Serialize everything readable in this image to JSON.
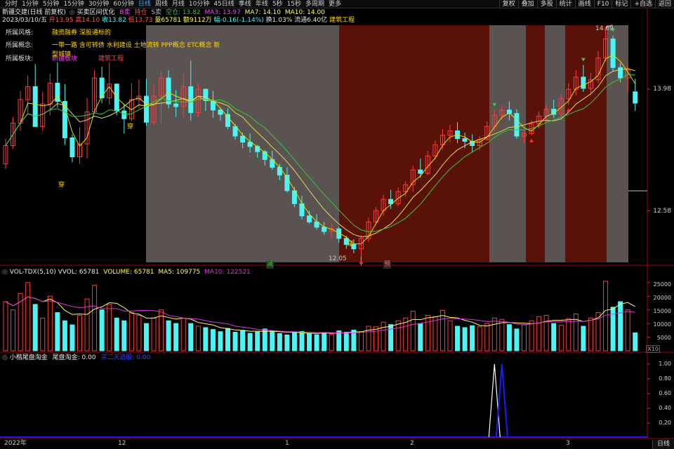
{
  "topbar": {
    "periods": [
      "分时",
      "1分钟",
      "5分钟",
      "15分钟",
      "30分钟",
      "60分钟",
      "日线",
      "周线",
      "月线",
      "10分钟",
      "45日线",
      "季线",
      "年线",
      "5秒",
      "15秒",
      "多周期",
      "更多"
    ],
    "active": "日线",
    "tools": [
      "复权",
      "叠加",
      "多股",
      "统计",
      "画线",
      "F10",
      "标记",
      "+自选",
      "返回"
    ]
  },
  "header": {
    "stock": "新疆交建(日线 前复权)",
    "indicator": "买卖区间优化",
    "sig_b": "B卖",
    "sig_h": "持仓",
    "sig_s": "S卖",
    "empty": "空仓: 13.82",
    "ma3": "MA3: 13.97",
    "ma7": "MA7: 14.10",
    "ma10": "MA10: 14.00"
  },
  "ohlc": {
    "date": "2023/03/10/五",
    "open": "开13.95",
    "high": "高14.10",
    "low": "低13.73",
    "close": "收13.82",
    "vol": "量65781",
    "amount": "额9112万",
    "chg": "幅-0.16(-1.14%)",
    "turnover": "换1.03%",
    "flow": "流通6.40亿",
    "sector": "建筑工程"
  },
  "info": {
    "style_k": "所属风格:",
    "style_v": "融资融券 深股通标的",
    "concept_k": "所属概念:",
    "concept_v": "一带一路 含可转债 水利建设 土地流转 PPP概念 ETC概念 新型城镇",
    "block_k": "所属板块:",
    "block_a": "新疆板块",
    "block_b": "建筑工程"
  },
  "annotations": {
    "high": "14.69",
    "low": "12.05",
    "chuan": "穿",
    "jian": "减",
    "yu": "预"
  },
  "price_axis": [
    "13.98",
    "12.58"
  ],
  "vol_header": {
    "name": "VOL-TDX(5,10)",
    "vvol": "VVOL: 65781",
    "volume": "VOLUME: 65781",
    "ma5": "MA5: 109775",
    "ma10": "MA10: 122521"
  },
  "vol_axis": [
    "25000",
    "20000",
    "15000",
    "10000",
    "5000"
  ],
  "vol_unit": "X10",
  "osc_header": {
    "name": "小楷尾盘淘金",
    "val1": "尾盘淘金: 0.00",
    "val2": "买二天选股: 0.00"
  },
  "osc_axis": [
    "1.00",
    "0.80",
    "0.60",
    "0.40",
    "0.20"
  ],
  "date_axis": [
    "2022年",
    "12",
    "1",
    "2",
    "3"
  ],
  "bottom_tab": "日线",
  "colors": {
    "up": "#ff3b3b",
    "down": "#4cf5f5",
    "bg_red": "#5a1208",
    "bg_gray": "#5b5252",
    "ma_a": "#e0e000",
    "ma_b": "#33cc33",
    "vol_ma5": "#ffff66",
    "vol_ma10": "#dd33dd",
    "osc_w": "#ffffff",
    "osc_b": "#1a1aff"
  },
  "chart_data": {
    "type": "candlestick",
    "candles": [
      [
        13.12,
        13.41,
        13.06,
        13.33
      ],
      [
        13.33,
        13.66,
        13.29,
        13.59
      ],
      [
        13.59,
        13.96,
        13.5,
        13.86
      ],
      [
        13.86,
        14.14,
        13.71,
        14.01
      ],
      [
        14.01,
        14.27,
        13.56,
        13.55
      ],
      [
        13.55,
        13.95,
        13.5,
        13.81
      ],
      [
        13.81,
        14.16,
        13.68,
        14.05
      ],
      [
        14.05,
        14.29,
        13.77,
        13.84
      ],
      [
        13.84,
        14.04,
        13.34,
        13.42
      ],
      [
        13.42,
        13.46,
        13.14,
        13.2
      ],
      [
        13.2,
        13.54,
        13.12,
        13.35
      ],
      [
        13.35,
        13.88,
        13.18,
        13.72
      ],
      [
        13.72,
        14.2,
        13.7,
        14.11
      ],
      [
        14.11,
        14.24,
        13.82,
        13.88
      ],
      [
        13.88,
        14.29,
        13.8,
        14.04
      ],
      [
        14.04,
        14.04,
        13.68,
        13.73
      ],
      [
        13.73,
        13.81,
        13.47,
        13.64
      ],
      [
        13.64,
        14.05,
        13.61,
        13.86
      ],
      [
        13.86,
        14.09,
        13.76,
        13.9
      ],
      [
        13.9,
        14.1,
        13.56,
        13.6
      ],
      [
        13.6,
        14.03,
        13.57,
        13.9
      ],
      [
        13.9,
        14.18,
        13.59,
        14.11
      ],
      [
        14.11,
        14.2,
        13.76,
        13.81
      ],
      [
        13.81,
        13.97,
        13.66,
        13.78
      ],
      [
        13.78,
        14.16,
        13.66,
        14.01
      ],
      [
        14.01,
        14.31,
        13.62,
        13.71
      ],
      [
        13.71,
        14.05,
        13.66,
        13.98
      ],
      [
        13.98,
        13.99,
        13.73,
        13.85
      ],
      [
        13.85,
        13.96,
        13.65,
        13.74
      ],
      [
        13.74,
        13.77,
        13.62,
        13.69
      ],
      [
        13.69,
        13.76,
        13.52,
        13.55
      ],
      [
        13.55,
        13.58,
        13.4,
        13.44
      ],
      [
        13.44,
        13.48,
        13.3,
        13.37
      ],
      [
        13.37,
        13.47,
        13.25,
        13.32
      ],
      [
        13.32,
        13.34,
        13.19,
        13.26
      ],
      [
        13.26,
        13.28,
        13.1,
        13.17
      ],
      [
        13.17,
        13.27,
        13.05,
        13.08
      ],
      [
        13.08,
        13.12,
        12.93,
        12.99
      ],
      [
        12.99,
        13.08,
        12.79,
        12.81
      ],
      [
        12.81,
        12.85,
        12.62,
        12.66
      ],
      [
        12.66,
        12.75,
        12.48,
        12.52
      ],
      [
        12.52,
        12.58,
        12.43,
        12.45
      ],
      [
        12.45,
        12.54,
        12.36,
        12.39
      ],
      [
        12.39,
        12.45,
        12.3,
        12.34
      ],
      [
        12.34,
        12.44,
        12.26,
        12.37
      ],
      [
        12.37,
        12.4,
        12.21,
        12.26
      ],
      [
        12.26,
        12.29,
        12.14,
        12.19
      ],
      [
        12.19,
        12.25,
        12.09,
        12.14
      ],
      [
        12.14,
        12.3,
        12.05,
        12.26
      ],
      [
        12.26,
        12.5,
        12.22,
        12.45
      ],
      [
        12.45,
        12.62,
        12.42,
        12.58
      ],
      [
        12.58,
        12.76,
        12.52,
        12.71
      ],
      [
        12.71,
        12.82,
        12.6,
        12.66
      ],
      [
        12.66,
        12.85,
        12.63,
        12.8
      ],
      [
        12.8,
        12.92,
        12.74,
        12.88
      ],
      [
        12.88,
        13.1,
        12.8,
        13.05
      ],
      [
        13.05,
        13.18,
        12.96,
        13.01
      ],
      [
        13.01,
        13.27,
        12.99,
        13.21
      ],
      [
        13.21,
        13.39,
        13.17,
        13.34
      ],
      [
        13.34,
        13.52,
        13.29,
        13.45
      ],
      [
        13.45,
        13.57,
        13.37,
        13.5
      ],
      [
        13.5,
        13.6,
        13.36,
        13.41
      ],
      [
        13.41,
        13.48,
        13.3,
        13.38
      ],
      [
        13.38,
        13.46,
        13.25,
        13.33
      ],
      [
        13.33,
        13.44,
        13.28,
        13.4
      ],
      [
        13.4,
        13.61,
        13.39,
        13.55
      ],
      [
        13.55,
        13.74,
        13.5,
        13.68
      ],
      [
        13.68,
        13.79,
        13.63,
        13.74
      ],
      [
        13.74,
        13.84,
        13.62,
        13.7
      ],
      [
        13.7,
        13.75,
        13.41,
        13.44
      ],
      [
        13.44,
        13.5,
        13.36,
        13.47
      ],
      [
        13.47,
        13.62,
        13.45,
        13.58
      ],
      [
        13.58,
        13.72,
        13.53,
        13.67
      ],
      [
        13.67,
        13.8,
        13.61,
        13.75
      ],
      [
        13.75,
        13.86,
        13.65,
        13.69
      ],
      [
        13.69,
        13.92,
        13.66,
        13.87
      ],
      [
        13.87,
        14.05,
        13.8,
        13.98
      ],
      [
        13.98,
        14.2,
        13.91,
        14.12
      ],
      [
        14.12,
        14.26,
        13.95,
        13.99
      ],
      [
        13.99,
        14.17,
        13.91,
        14.09
      ],
      [
        14.09,
        14.42,
        14.05,
        14.34
      ],
      [
        14.34,
        14.69,
        14.3,
        14.56
      ],
      [
        14.56,
        14.6,
        14.19,
        14.23
      ],
      [
        14.23,
        14.28,
        14.06,
        14.11
      ],
      [
        14.11,
        14.25,
        13.95,
        14.2
      ],
      [
        13.95,
        14.1,
        13.73,
        13.82
      ]
    ],
    "volumes": [
      18000,
      15000,
      21000,
      25000,
      17000,
      12000,
      20000,
      14000,
      11000,
      9500,
      13000,
      19000,
      24000,
      15000,
      17000,
      12000,
      11000,
      14000,
      13000,
      10000,
      12000,
      15000,
      11000,
      10000,
      12000,
      10000,
      9000,
      8500,
      7800,
      7000,
      8200,
      6800,
      7500,
      6400,
      6900,
      8000,
      7200,
      6300,
      5800,
      6600,
      7100,
      6400,
      5900,
      6700,
      6100,
      7300,
      6800,
      7600,
      7000,
      9000,
      8800,
      10500,
      9600,
      11000,
      12000,
      14500,
      10000,
      13000,
      12500,
      14800,
      11000,
      9000,
      8500,
      9200,
      8800,
      10000,
      12000,
      11500,
      9600,
      8000,
      9500,
      11000,
      12500,
      13000,
      10000,
      9400,
      11800,
      13500,
      9000,
      12000,
      14000,
      25500,
      16000,
      18000,
      15000,
      6578
    ],
    "price_axis_values": [
      13.98,
      12.58
    ],
    "high_mark": 14.69,
    "low_mark": 12.05,
    "osc_peaks": [
      {
        "series": "white",
        "value": 1.0
      },
      {
        "series": "blue",
        "value": 1.0
      }
    ]
  }
}
